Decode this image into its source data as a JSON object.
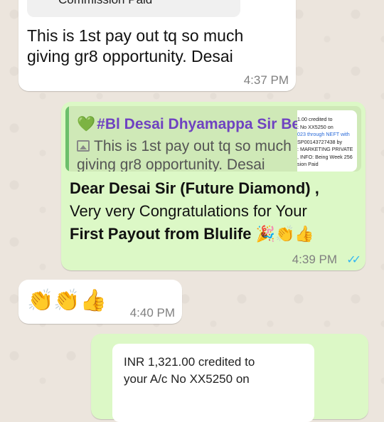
{
  "messages": [
    {
      "direction": "incoming",
      "doc_label": "Commission Paid",
      "text": "This is 1st pay out tq so much giving gr8 opportunity. Desai",
      "time": "4:37 PM"
    },
    {
      "direction": "outgoing",
      "quote": {
        "author": "#Bl Desai Dhyamappa Sir Be...",
        "text": "This is 1st pay out tq so much giving gr8 opportunity. Desai",
        "thumbnail_lines": [
          "1.00 credited to",
          ": No XX5250 on",
          "023 through NEFT with",
          "SP00143727438 by",
          ": MARKETING PRIVATE",
          ", INFO: Being Week 256",
          "sion Paid"
        ]
      },
      "line1": "Dear Desai Sir (Future Diamond) ,",
      "line2": "Very very Congratulations for Your",
      "line3": "First Payout from Blulife",
      "line3_emojis": "🎉👏👍",
      "time": "4:39 PM",
      "status": "read",
      "accent_ticks": "#34b7f1"
    },
    {
      "direction": "incoming",
      "emojis": "👏👏👍",
      "time": "4:40 PM"
    },
    {
      "direction": "outgoing",
      "card_line1": "INR 1,321.00 credited to",
      "card_line2": "your A/c No XX5250 on"
    }
  ],
  "colors": {
    "incoming_bubble": "#ffffff",
    "outgoing_bubble": "#dcf8c6",
    "quote_author": "#6f42c1"
  }
}
